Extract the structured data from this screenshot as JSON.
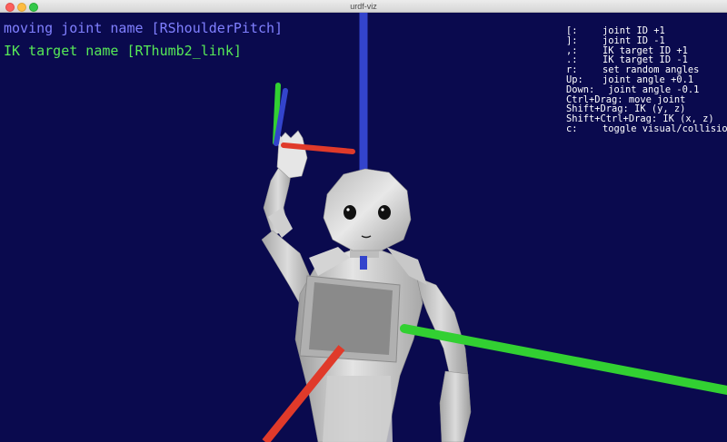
{
  "window": {
    "title": "urdf-viz"
  },
  "overlay": {
    "moving_joint_text": "moving joint name [RShoulderPitch]",
    "ik_target_text": "IK target name [RThumb2_link]"
  },
  "help": {
    "rows": [
      {
        "key": "[:",
        "desc": "joint ID +1"
      },
      {
        "key": "]:",
        "desc": "joint ID -1"
      },
      {
        "key": ",:",
        "desc": "IK target ID +1"
      },
      {
        "key": ".:",
        "desc": "IK target ID -1"
      },
      {
        "key": "r:",
        "desc": "set random angles"
      },
      {
        "key": "Up:",
        "desc": "joint angle +0.1"
      },
      {
        "key": "Down:",
        "desc": "joint angle -0.1"
      },
      {
        "key": "Ctrl+Drag:",
        "desc": "move joint"
      },
      {
        "key": "Shift+Drag:",
        "desc": "IK (y, z)"
      },
      {
        "key": "Shift+Ctrl+Drag:",
        "desc": "IK (x, z)"
      },
      {
        "key": "c:",
        "desc": "toggle visual/collision"
      }
    ]
  },
  "colors": {
    "background": "#0a0a4e",
    "joint_label": "#8080ff",
    "ik_label": "#57e957",
    "axis_x": "#e03a2a",
    "axis_y": "#32d032",
    "axis_z": "#3344cc"
  }
}
